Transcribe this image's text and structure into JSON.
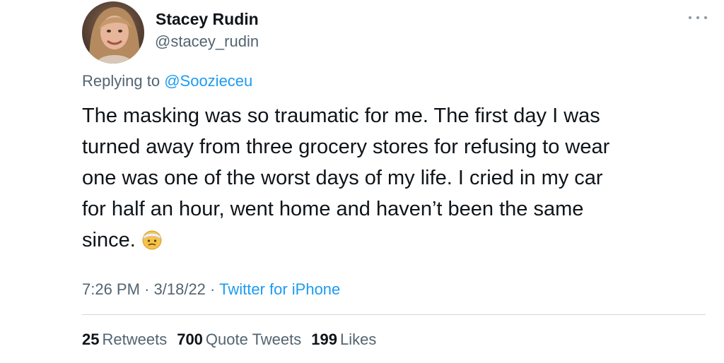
{
  "author": {
    "name": "Stacey Rudin",
    "handle": "@stacey_rudin",
    "avatar_icon": "profile-photo"
  },
  "reply": {
    "prefix": "Replying to",
    "mention": "@Soozieceu"
  },
  "tweet": {
    "lines": [
      "The masking was so traumatic for me. The first day I was",
      "turned away from three grocery stores for refusing to wear",
      "one was one of the worst days of my life. I cried in my car",
      "for half an hour, went home and haven’t been the same",
      "since."
    ],
    "emoji_icon": "face-with-head-bandage-emoji"
  },
  "meta": {
    "time": "7:26 PM",
    "date": "3/18/22",
    "separator": "·",
    "source": "Twitter for iPhone"
  },
  "stats": {
    "retweets_count": "25",
    "retweets_label": "Retweets",
    "quotes_count": "700",
    "quotes_label": "Quote Tweets",
    "likes_count": "199",
    "likes_label": "Likes"
  },
  "colors": {
    "accent": "#1d9bf0",
    "text_primary": "#0f1419",
    "text_secondary": "#536471",
    "divider": "#cfd9de"
  }
}
